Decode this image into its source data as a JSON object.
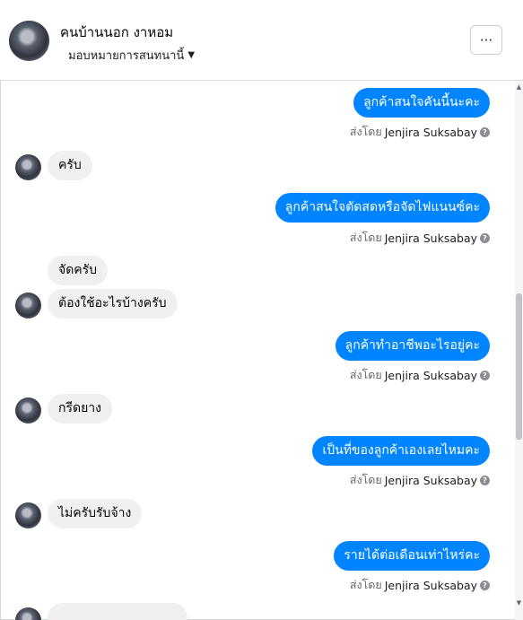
{
  "header": {
    "title": "คนบ้านนอก งาหอม",
    "assign_label": "มอบหมายการสนทนานี้",
    "caret_icon": "caret-down-icon",
    "more_label": "···"
  },
  "sent_by_prefix": "ส่งโดย",
  "agent_name": "Jenjira Suksabay",
  "messages": [
    {
      "dir": "out",
      "text": "ลูกค้าสนใจคันนี้นะคะ"
    },
    {
      "dir": "in",
      "text": "ครับ"
    },
    {
      "dir": "out",
      "text": "ลูกค้าสนใจตัดสดหรือจัดไฟแนนซ์คะ"
    },
    {
      "dir": "in",
      "text": "จัดครับ"
    },
    {
      "dir": "in",
      "text": "ต้องใช้อะไรบ้างครับ"
    },
    {
      "dir": "out",
      "text": "ลูกค้าทำอาชีพอะไรอยู่คะ"
    },
    {
      "dir": "in",
      "text": "กรีดยาง"
    },
    {
      "dir": "out",
      "text": "เป็นที่ของลูกค้าเองเลยไหมคะ"
    },
    {
      "dir": "in",
      "text": "ไม่ครับรับจ้าง"
    },
    {
      "dir": "out",
      "text": "รายได้ต่อเดือนเท่าไหร่คะ"
    }
  ]
}
